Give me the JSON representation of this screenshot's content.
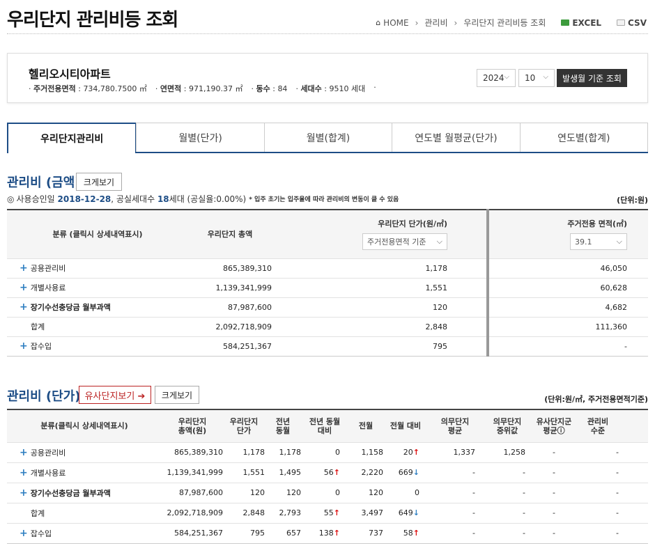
{
  "page": {
    "title": "우리단지 관리비등 조회"
  },
  "breadcrumb": {
    "home": "HOME",
    "level1": "관리비",
    "level2": "우리단지 관리비등 조회"
  },
  "export": {
    "excel": "EXCEL",
    "csv": "CSV"
  },
  "apartment": {
    "name": "헬리오시티아파트",
    "info": [
      {
        "label": "주거전용면적",
        "value": "734,780.7500 ㎡"
      },
      {
        "label": "연면적",
        "value": "971,190.37 ㎡"
      },
      {
        "label": "동수",
        "value": "84"
      },
      {
        "label": "세대수",
        "value": "9510 세대"
      }
    ],
    "trailing_dot": "·",
    "year": "2024",
    "month": "10",
    "query_button": "발생월 기준 조회"
  },
  "tabs": [
    "우리단지관리비",
    "월별(단가)",
    "월별(합계)",
    "연도별 월평균(단가)",
    "연도별(합계)"
  ],
  "section1": {
    "title": "관리비 (금액)",
    "enlarge": "크게보기",
    "approval_label": "사용승인일",
    "approval_date": "2018-12-28",
    "vacant_text": ", 공실세대수",
    "vacant_count": "18",
    "vacant_unit": "세대 (공실율:0.00%)",
    "note": "* 입주 초기는 입주율에 따라 관리비의 변동이 클 수 있음",
    "unit": "(단위:원)",
    "headers": {
      "category": "분류 (클릭시 상세내역표시)",
      "total": "우리단지 총액",
      "unit_price": "우리단지 단가(원/㎡)",
      "unit_price_basis": "주거전용면적 기준",
      "area": "주거전용 면적(㎡)",
      "area_value": "39.1"
    },
    "rows": [
      {
        "plus": "+",
        "name": "공용관리비",
        "total": "865,389,310",
        "unit": "1,178",
        "area": "46,050"
      },
      {
        "plus": "+",
        "name": "개별사용료",
        "total": "1,139,341,999",
        "unit": "1,551",
        "area": "60,628"
      },
      {
        "plus": "+",
        "name": "장기수선충당금 월부과액",
        "total": "87,987,600",
        "unit": "120",
        "area": "4,682"
      },
      {
        "plus": "",
        "name": "합계",
        "total": "2,092,718,909",
        "unit": "2,848",
        "area": "111,360"
      },
      {
        "plus": "+",
        "name": "잡수입",
        "total": "584,251,367",
        "unit": "795",
        "area": "-"
      }
    ]
  },
  "section2": {
    "title": "관리비 (단가)",
    "similar_button": "유사단지보기 ➔",
    "enlarge": "크게보기",
    "unit": "(단위:원/㎡, 주거전용면적기준)",
    "headers": [
      "분류(클릭시 상세내역표시)",
      "우리단지\n총액(원)",
      "우리단지\n단가",
      "전년\n동월",
      "전년 동월\n대비",
      "전월",
      "전월 대비",
      "의무단지\n평균",
      "의무단지\n중위값",
      "유사단지군\n평균ⓘ",
      "관리비\n수준"
    ],
    "rows": [
      {
        "plus": "+",
        "name": "공용관리비",
        "total": "865,389,310",
        "unit": "1,178",
        "prev_year": "1,178",
        "yoy": "0",
        "yoy_dir": "",
        "prev_month": "1,158",
        "mom": "20",
        "mom_dir": "↑",
        "avg": "1,337",
        "median": "1,258",
        "similar": "-",
        "level": "-"
      },
      {
        "plus": "+",
        "name": "개별사용료",
        "total": "1,139,341,999",
        "unit": "1,551",
        "prev_year": "1,495",
        "yoy": "56",
        "yoy_dir": "↑",
        "prev_month": "2,220",
        "mom": "669",
        "mom_dir": "↓",
        "avg": "-",
        "median": "-",
        "similar": "-",
        "level": "-"
      },
      {
        "plus": "+",
        "name": "장기수선충당금 월부과액",
        "total": "87,987,600",
        "unit": "120",
        "prev_year": "120",
        "yoy": "0",
        "yoy_dir": "",
        "prev_month": "120",
        "mom": "0",
        "mom_dir": "",
        "avg": "-",
        "median": "-",
        "similar": "-",
        "level": "-"
      },
      {
        "plus": "",
        "name": "합계",
        "total": "2,092,718,909",
        "unit": "2,848",
        "prev_year": "2,793",
        "yoy": "55",
        "yoy_dir": "↑",
        "prev_month": "3,497",
        "mom": "649",
        "mom_dir": "↓",
        "avg": "-",
        "median": "-",
        "similar": "-",
        "level": "-"
      },
      {
        "plus": "+",
        "name": "잡수입",
        "total": "584,251,367",
        "unit": "795",
        "prev_year": "657",
        "yoy": "138",
        "yoy_dir": "↑",
        "prev_month": "737",
        "mom": "58",
        "mom_dir": "↑",
        "avg": "-",
        "median": "-",
        "similar": "-",
        "level": "-"
      }
    ]
  }
}
